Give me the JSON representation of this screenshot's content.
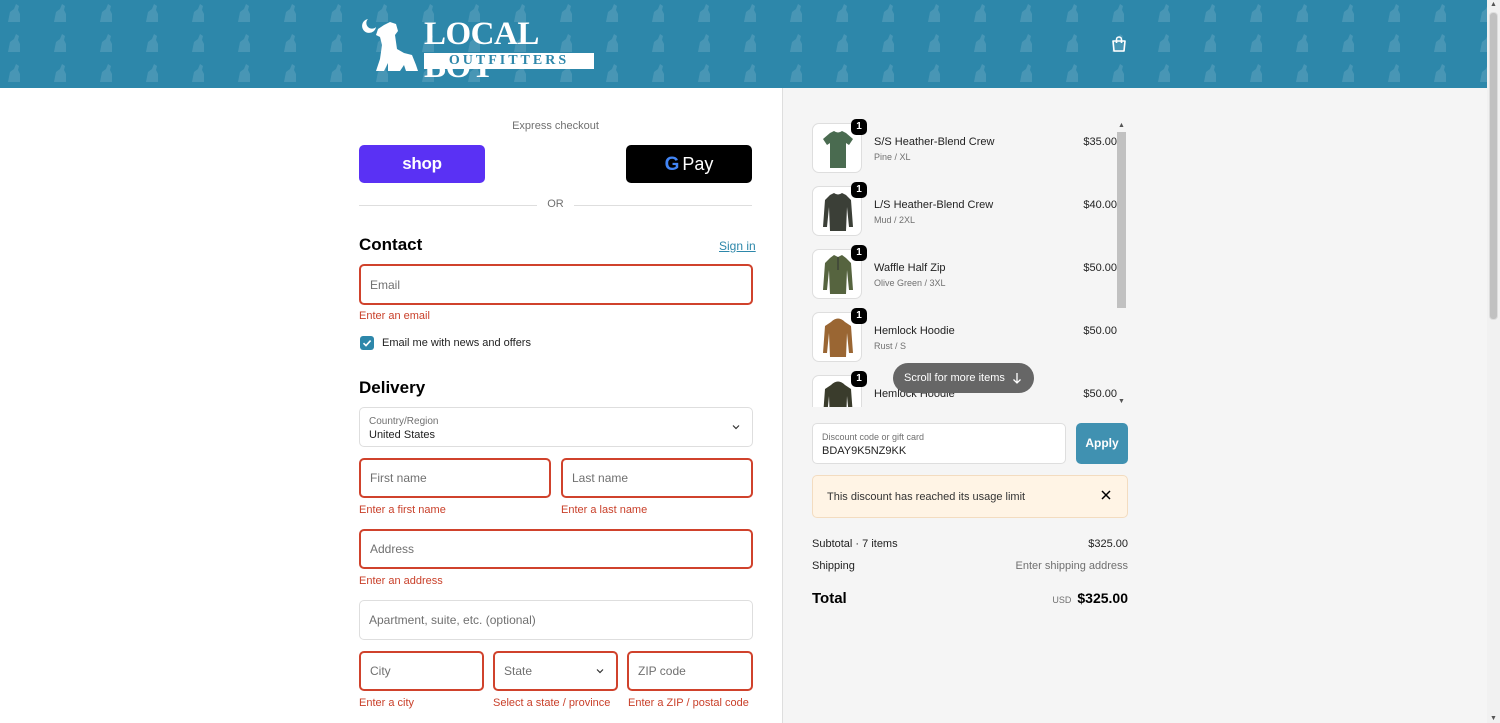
{
  "brand": {
    "name_main": "LOCAL BOY",
    "name_sub": "OUTFITTERS"
  },
  "header": {
    "cart_icon": "shopping-bag-icon"
  },
  "express": {
    "label": "Express checkout",
    "shop_label": "shop",
    "gpay_label": "Pay",
    "or_label": "OR"
  },
  "contact": {
    "title": "Contact",
    "sign_in": "Sign in",
    "email_placeholder": "Email",
    "email_error": "Enter an email",
    "newsletter_label": "Email me with news and offers",
    "newsletter_checked": true
  },
  "delivery": {
    "title": "Delivery",
    "country_label": "Country/Region",
    "country_value": "United States",
    "first_name_placeholder": "First name",
    "first_name_error": "Enter a first name",
    "last_name_placeholder": "Last name",
    "last_name_error": "Enter a last name",
    "address_placeholder": "Address",
    "address_error": "Enter an address",
    "apartment_placeholder": "Apartment, suite, etc. (optional)",
    "city_placeholder": "City",
    "city_error": "Enter a city",
    "state_placeholder": "State",
    "state_error": "Select a state / province",
    "zip_placeholder": "ZIP code",
    "zip_error": "Enter a ZIP / postal code"
  },
  "cart": {
    "items": [
      {
        "name": "S/S Heather-Blend Crew",
        "variant": "Pine / XL",
        "price": "$35.00",
        "qty": "1",
        "color": "#4a6b50"
      },
      {
        "name": "L/S Heather-Blend Crew",
        "variant": "Mud / 2XL",
        "price": "$40.00",
        "qty": "1",
        "color": "#3b3f37"
      },
      {
        "name": "Waffle Half Zip",
        "variant": "Olive Green / 3XL",
        "price": "$50.00",
        "qty": "1",
        "color": "#56643f"
      },
      {
        "name": "Hemlock Hoodie",
        "variant": "Rust / S",
        "price": "$50.00",
        "qty": "1",
        "color": "#9a6633"
      },
      {
        "name": "Hemlock Hoodie",
        "variant": "",
        "price": "$50.00",
        "qty": "1",
        "color": "#3a3c2c"
      }
    ],
    "scroll_hint": "Scroll for more items"
  },
  "discount": {
    "label": "Discount code or gift card",
    "value": "BDAY9K5NZ9KK",
    "apply_label": "Apply",
    "alert_message": "This discount has reached its usage limit"
  },
  "summary": {
    "subtotal_label": "Subtotal · 7 items",
    "subtotal_value": "$325.00",
    "shipping_label": "Shipping",
    "shipping_value": "Enter shipping address",
    "total_label": "Total",
    "currency": "USD",
    "total_value": "$325.00"
  },
  "colors": {
    "brand": "#2d87aa",
    "error": "#d0422c",
    "shop": "#5a31f4"
  }
}
